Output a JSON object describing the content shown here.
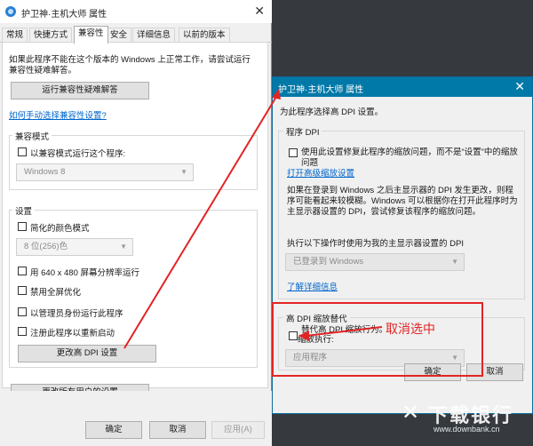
{
  "left_dialog": {
    "title": "护卫神·主机大师 属性",
    "close": "✕",
    "tabs": [
      "常规",
      "快捷方式",
      "兼容性",
      "安全",
      "详细信息",
      "以前的版本"
    ],
    "intro": "如果此程序不能在这个版本的 Windows 上正常工作，请尝试运行兼容性疑难解答。",
    "troubleshoot_button": "运行兼容性疑难解答",
    "manual_link": "如何手动选择兼容性设置?",
    "compat_mode": {
      "label": "兼容模式",
      "check_label": "以兼容模式运行这个程序:",
      "select_value": "Windows 8"
    },
    "settings": {
      "label": "设置",
      "reduced_color_label": "简化的颜色模式",
      "color_select_value": "8 位(256)色",
      "res_640_label": "用 640 x 480 屏幕分辨率运行",
      "fullscreen_label": "禁用全屏优化",
      "admin_label": "以管理员身份运行此程序",
      "register_restart_label": "注册此程序以重新启动",
      "change_dpi_button": "更改高 DPI 设置"
    },
    "all_users_button": "更改所有用户的设置",
    "footer": {
      "ok": "确定",
      "cancel": "取消",
      "apply": "应用(A)"
    }
  },
  "right_dialog": {
    "title": "护卫神·主机大师 属性",
    "close": "✕",
    "heading": "为此程序选择高 DPI 设置。",
    "program_dpi": {
      "label": "程序 DPI",
      "check_label": "使用此设置修复此程序的缩放问题，而不是“设置”中的缩放问题",
      "link_advanced": "打开高级缩放设置",
      "desc": "如果在登录到 Windows 之后主显示器的 DPI 发生更改，则程序可能看起来较模糊。Windows 可以根据你在打开此程序时为主显示器设置的 DPI，尝试修复该程序的缩放问题。",
      "use_dpi_label": "执行以下操作时使用为我的主显示器设置的 DPI",
      "select_value": "已登录到 Windows",
      "learn_more": "了解详细信息"
    },
    "override": {
      "label": "高 DPI 缩放替代",
      "check_label": "替代高 DPI 缩放行为。",
      "performed_by": "缩放执行:",
      "select_value": "应用程序"
    },
    "footer": {
      "ok": "确定",
      "cancel": "取消"
    }
  },
  "annotation": {
    "cancel_note": "取消选中"
  },
  "watermark": {
    "icon": "✕",
    "text": "下载银行",
    "url": "www.downbank.cn"
  },
  "colors": {
    "accent_title": "#0078a8",
    "highlight": "#e22424",
    "link": "#0066cc"
  }
}
